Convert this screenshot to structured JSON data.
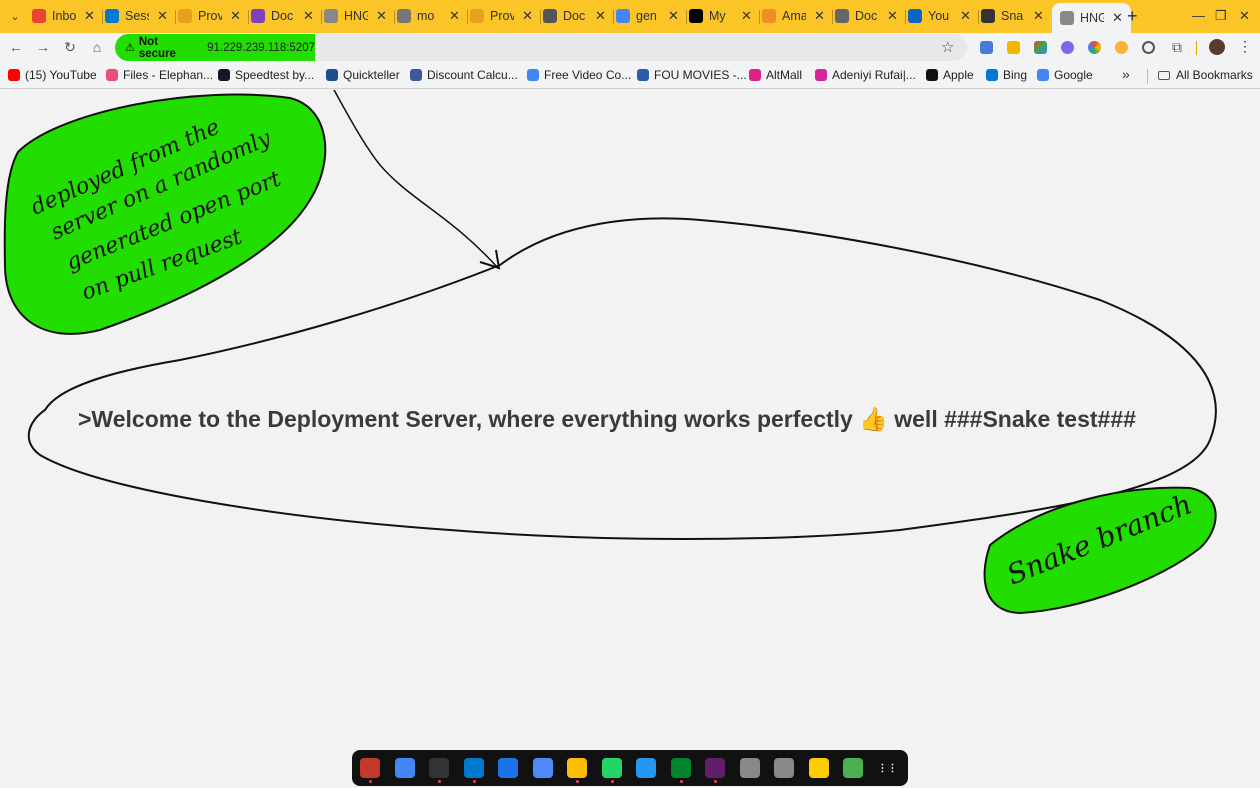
{
  "browser": {
    "tabs": [
      {
        "title": "Inbo",
        "favicon": "gmail-icon",
        "color": "#ea4335"
      },
      {
        "title": "Sess",
        "favicon": "azure-icon",
        "color": "#0078d4"
      },
      {
        "title": "Prov",
        "favicon": "hashicorp-icon",
        "color": "#e6a020"
      },
      {
        "title": "Doc",
        "favicon": "terraform-icon",
        "color": "#7b42bc"
      },
      {
        "title": "HNG",
        "favicon": "hng-icon",
        "color": "#888888"
      },
      {
        "title": "mo",
        "favicon": "loading-icon",
        "color": "#777777"
      },
      {
        "title": "Prov",
        "favicon": "hashicorp-icon",
        "color": "#e6a020"
      },
      {
        "title": "Doc",
        "favicon": "docs-icon",
        "color": "#555555"
      },
      {
        "title": "gen",
        "favicon": "gemini-icon",
        "color": "#4285f4"
      },
      {
        "title": "My",
        "favicon": "dev-icon",
        "color": "#000000"
      },
      {
        "title": "Ama",
        "favicon": "amazon-icon",
        "color": "#f28c28"
      },
      {
        "title": "Doc",
        "favicon": "docs-icon",
        "color": "#666666"
      },
      {
        "title": "You",
        "favicon": "linkedin-icon",
        "color": "#0a66c2"
      },
      {
        "title": "Sna",
        "favicon": "github-icon",
        "color": "#333333"
      },
      {
        "title": "HNG",
        "favicon": "hng-icon",
        "color": "#888888",
        "active": true
      }
    ],
    "toolbar": {
      "security_label": "Not secure",
      "url": "91.229.239.118:5207"
    },
    "bookmarks": [
      {
        "label": "(15) YouTube",
        "color": "#ff0000"
      },
      {
        "label": "Files - Elephan...",
        "color": "#e94e77"
      },
      {
        "label": "Speedtest by...",
        "color": "#141526"
      },
      {
        "label": "Quickteller",
        "color": "#1c4d8c"
      },
      {
        "label": "Discount Calcu...",
        "color": "#3b5998"
      },
      {
        "label": "Free Video Co...",
        "color": "#4285f4"
      },
      {
        "label": "FOU MOVIES -...",
        "color": "#2a5caa"
      },
      {
        "label": "AltMall",
        "color": "#e0218a"
      },
      {
        "label": "Adeniyi Rufai|...",
        "color": "#d6249f"
      },
      {
        "label": "Apple",
        "color": "#111111"
      },
      {
        "label": "Bing",
        "color": "#0078d4"
      },
      {
        "label": "Google",
        "color": "#4285f4"
      }
    ],
    "all_bookmarks_label": "All Bookmarks"
  },
  "page": {
    "welcome_text": ">Welcome to the Deployment Server, where everything works perfectly 👍 well ###Snake test###",
    "annotation_note_lines": [
      "deployed from the",
      "server on a randomly",
      "generated open port",
      "on pull request"
    ],
    "annotation_branch": "Snake branch",
    "highlight_color": "#22dd00"
  },
  "dock_apps": [
    {
      "name": "files-app-icon",
      "color": "#c0392b"
    },
    {
      "name": "docs-app-icon",
      "color": "#4285f4"
    },
    {
      "name": "terminal-app-icon",
      "color": "#333333"
    },
    {
      "name": "vscode-app-icon",
      "color": "#007acc"
    },
    {
      "name": "whiteboard-app-icon",
      "color": "#1a73e8"
    },
    {
      "name": "notes-app-icon",
      "color": "#4c8bf5"
    },
    {
      "name": "chrome-app-icon",
      "color": "#fbbc04"
    },
    {
      "name": "whatsapp-app-icon",
      "color": "#25d366"
    },
    {
      "name": "docker-app-icon",
      "color": "#2496ed"
    },
    {
      "name": "meet-app-icon",
      "color": "#00832d"
    },
    {
      "name": "slack-app-icon",
      "color": "#611f69"
    },
    {
      "name": "app-grey-1-icon",
      "color": "#888888"
    },
    {
      "name": "app-grey-2-icon",
      "color": "#888888"
    },
    {
      "name": "mtn-app-icon",
      "color": "#ffcc00"
    },
    {
      "name": "recycle-app-icon",
      "color": "#4caf50"
    },
    {
      "name": "launcher-icon",
      "color": "#111111"
    }
  ]
}
